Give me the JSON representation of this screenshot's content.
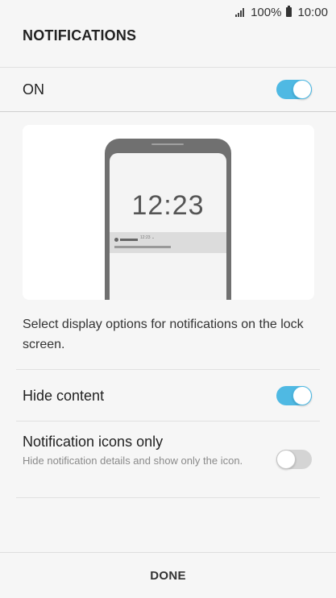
{
  "status_bar": {
    "battery_text": "100%",
    "time": "10:00"
  },
  "header": {
    "title": "NOTIFICATIONS"
  },
  "master_toggle": {
    "label": "ON",
    "state": "on"
  },
  "preview": {
    "lock_time": "12:23",
    "notif_time": "12:23 ⌄"
  },
  "description": "Select display options for notifications on the lock screen.",
  "options": [
    {
      "title": "Hide content",
      "subtitle": "",
      "state": "on"
    },
    {
      "title": "Notification icons only",
      "subtitle": "Hide notification details and show only the icon.",
      "state": "off"
    }
  ],
  "footer": {
    "done_label": "DONE"
  },
  "colors": {
    "accent": "#4fb9e3",
    "background": "#f6f6f6"
  },
  "icons": [
    "signal-icon",
    "battery-icon"
  ]
}
